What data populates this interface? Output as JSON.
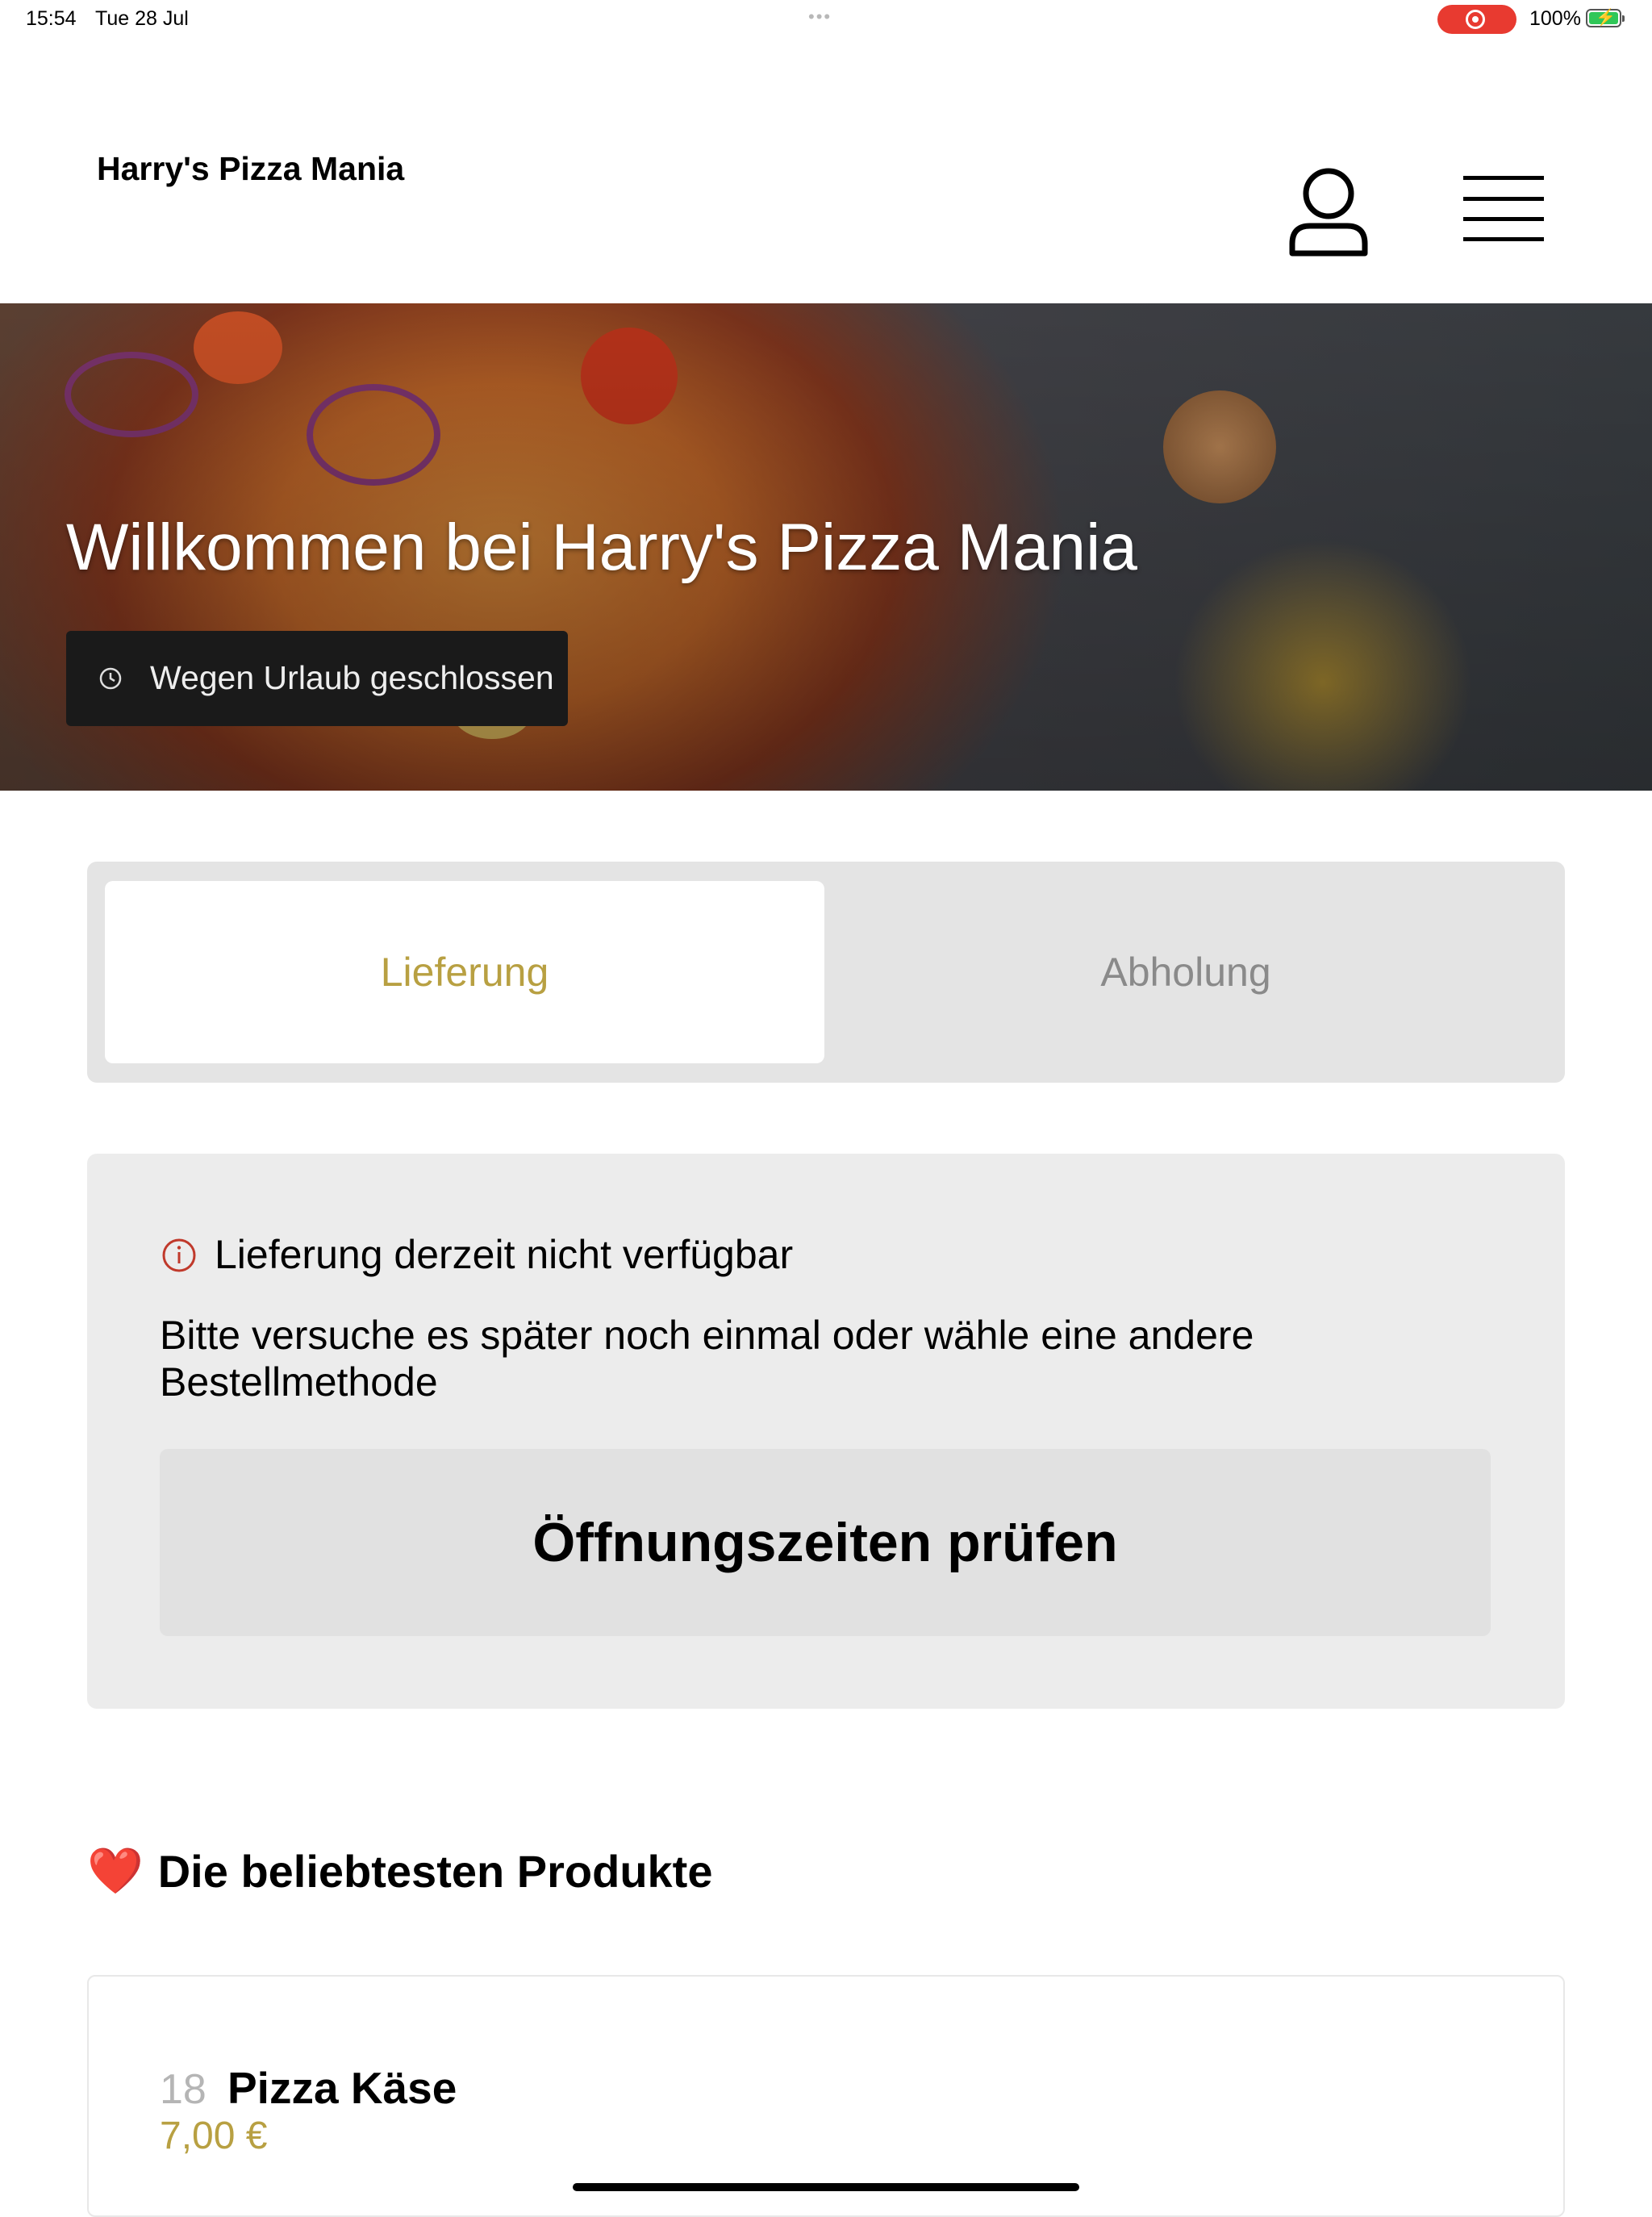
{
  "status_bar": {
    "time": "15:54",
    "date": "Tue 28 Jul",
    "battery": "100%"
  },
  "header": {
    "brand": "Harry's Pizza Mania"
  },
  "hero": {
    "title": "Willkommen bei Harry's Pizza Mania",
    "status_badge": "Wegen Urlaub geschlossen"
  },
  "order_mode": {
    "options": [
      "Lieferung",
      "Abholung"
    ],
    "selected": "Lieferung"
  },
  "notice": {
    "title": "Lieferung derzeit nicht verfügbar",
    "body": "Bitte versuche es später noch einmal oder wähle eine andere Bestellmethode",
    "button": "Öffnungszeiten prüfen"
  },
  "popular": {
    "emoji": "❤️",
    "title": "Die beliebtesten Produkte",
    "products": [
      {
        "number": "18",
        "name": "Pizza Käse",
        "price": "7,00 €"
      }
    ]
  },
  "colors": {
    "accent_gold": "#b8a042",
    "badge_bg": "#1a1a1a",
    "info_red": "#c0392b"
  }
}
